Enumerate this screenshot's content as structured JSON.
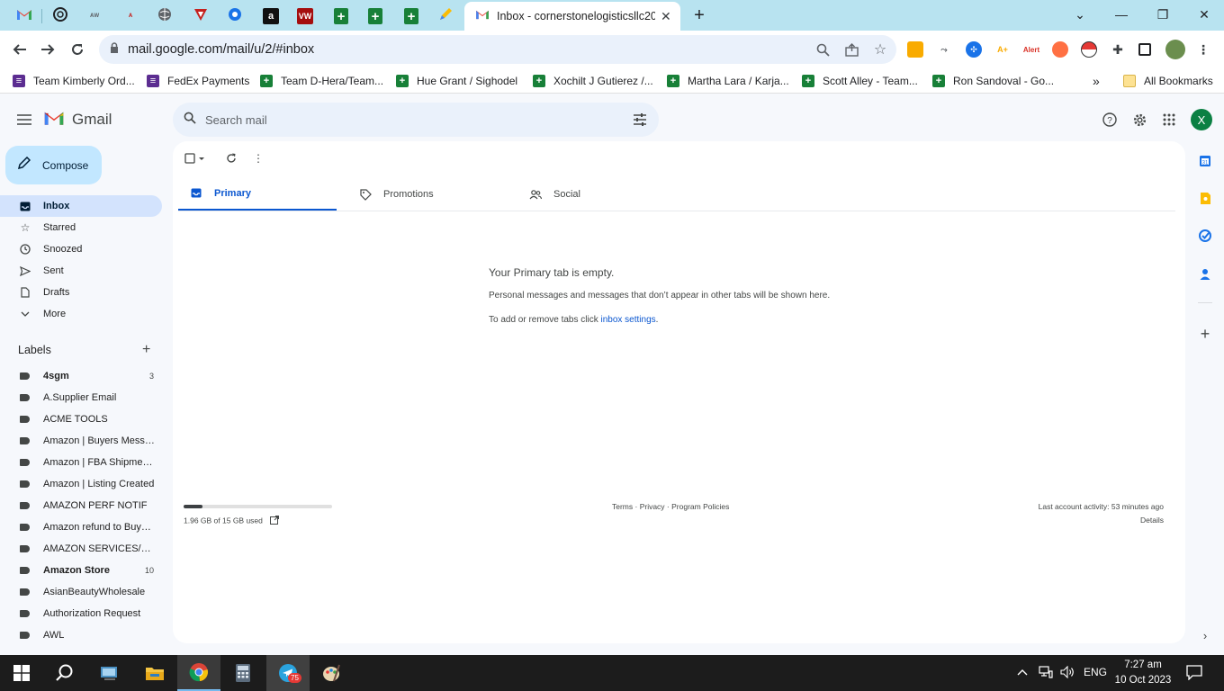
{
  "browser": {
    "active_tab_title": "Inbox - cornerstonelogisticsllc20",
    "url": "mail.google.com/mail/u/2/#inbox",
    "pinned_tabs": [
      "gmail-icon",
      "openai-icon",
      "tab-icon",
      "tab-icon",
      "globe-icon",
      "tab-icon",
      "tab-icon",
      "amazon-icon",
      "vw-icon",
      "sheets-icon",
      "sheets-icon",
      "sheets-icon",
      "tab-icon"
    ],
    "bookmarks": [
      "Team Kimberly Ord...",
      "FedEx Payments",
      "Team D-Hera/Team...",
      "Hue Grant / Sighodel",
      "Xochilt J Gutierez /...",
      "Martha Lara / Karja...",
      "Scott Alley - Team...",
      "Ron Sandoval - Go..."
    ],
    "all_bookmarks": "All Bookmarks"
  },
  "gmail": {
    "product": "Gmail",
    "search_placeholder": "Search mail",
    "avatar_letter": "X",
    "compose": "Compose",
    "nav": [
      {
        "label": "Inbox",
        "icon": "inbox-icon"
      },
      {
        "label": "Starred",
        "icon": "star-icon"
      },
      {
        "label": "Snoozed",
        "icon": "clock-icon"
      },
      {
        "label": "Sent",
        "icon": "send-icon"
      },
      {
        "label": "Drafts",
        "icon": "draft-icon"
      },
      {
        "label": "More",
        "icon": "chevron-down-icon"
      }
    ],
    "labels_heading": "Labels",
    "labels": [
      {
        "name": "4sgm",
        "count": "3",
        "bold": true
      },
      {
        "name": "A.Supplier Email",
        "count": "",
        "bold": false
      },
      {
        "name": "ACME TOOLS",
        "count": "",
        "bold": false
      },
      {
        "name": "Amazon | Buyers Messa...",
        "count": "",
        "bold": false
      },
      {
        "name": "Amazon | FBA Shipments",
        "count": "",
        "bold": false
      },
      {
        "name": "Amazon | Listing Created",
        "count": "",
        "bold": false
      },
      {
        "name": "AMAZON PERF NOTIF",
        "count": "",
        "bold": false
      },
      {
        "name": "Amazon refund to Buyers",
        "count": "",
        "bold": false
      },
      {
        "name": "AMAZON SERVICES/PAY...",
        "count": "",
        "bold": false
      },
      {
        "name": "Amazon Store",
        "count": "10",
        "bold": true
      },
      {
        "name": "AsianBeautyWholesale",
        "count": "",
        "bold": false
      },
      {
        "name": "Authorization Request",
        "count": "",
        "bold": false
      },
      {
        "name": "AWL",
        "count": "",
        "bold": false
      }
    ],
    "tabs": [
      {
        "label": "Primary",
        "icon": "inbox-icon",
        "active": true
      },
      {
        "label": "Promotions",
        "icon": "tag-icon",
        "active": false
      },
      {
        "label": "Social",
        "icon": "people-icon",
        "active": false
      }
    ],
    "empty": {
      "title": "Your Primary tab is empty.",
      "description": "Personal messages and messages that don’t appear in other tabs will be shown here.",
      "hint_prefix": "To add or remove tabs click ",
      "hint_link": "inbox settings",
      "hint_suffix": "."
    },
    "storage": {
      "text": "1.96 GB of 15 GB used",
      "fraction_used": 0.13
    },
    "footer": {
      "links": "Terms · Privacy · Program Policies",
      "activity": "Last account activity: 53 minutes ago",
      "details": "Details"
    }
  },
  "taskbar": {
    "language": "ENG",
    "time": "7:27 am",
    "date": "10 Oct 2023",
    "telegram_badge": "75"
  },
  "colors": {
    "accent": "#0b57d0",
    "compose": "#c2e7ff",
    "active_nav": "#d3e3fd",
    "tabstrip": "#b8e3f0"
  }
}
